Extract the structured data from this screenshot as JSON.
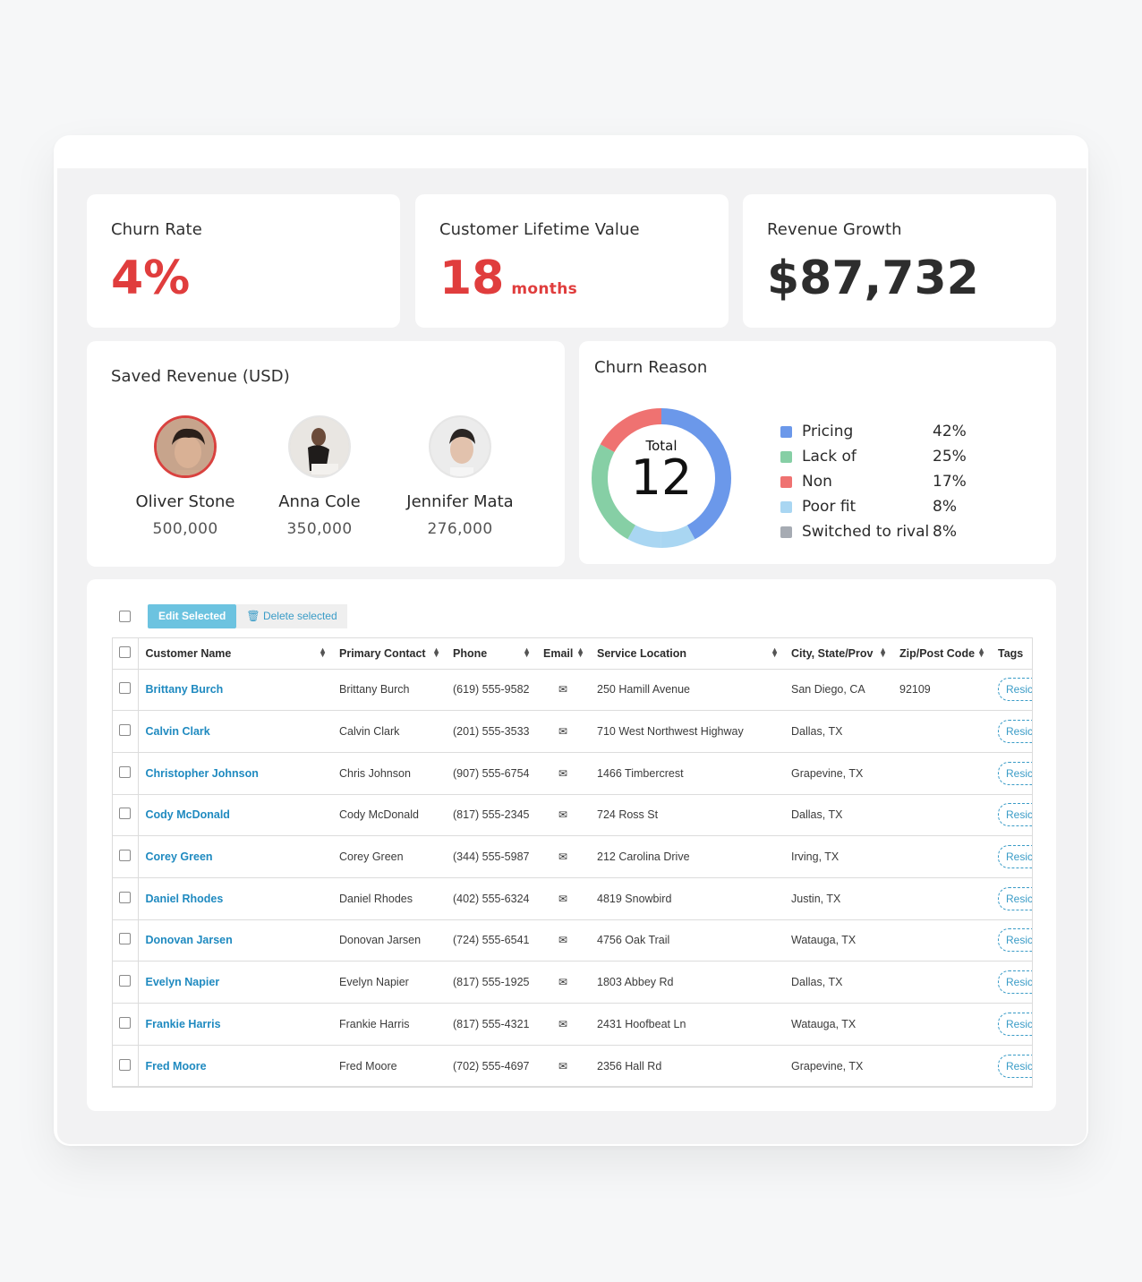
{
  "kpis": {
    "churn_rate": {
      "title": "Churn Rate",
      "value": "4%"
    },
    "clv": {
      "title": "Customer Lifetime Value",
      "value": "18",
      "unit": "months"
    },
    "revenue_growth": {
      "title": "Revenue Growth",
      "value": "$87,732"
    }
  },
  "saved_revenue": {
    "title": "Saved Revenue (USD)",
    "people": [
      {
        "name": "Oliver Stone",
        "value": "500,000"
      },
      {
        "name": "Anna Cole",
        "value": "350,000"
      },
      {
        "name": "Jennifer Mata",
        "value": "276,000"
      }
    ]
  },
  "churn_reason": {
    "title": "Churn Reason",
    "total_label": "Total",
    "total_value": "12",
    "legend": [
      {
        "label": "Pricing",
        "pct": "42%",
        "color": "#6b98ea"
      },
      {
        "label": "Lack of",
        "pct": "25%",
        "color": "#86cfa5"
      },
      {
        "label": "Non",
        "pct": "17%",
        "color": "#ef7271"
      },
      {
        "label": "Poor fit",
        "pct": "8%",
        "color": "#a9d6f2"
      },
      {
        "label": "Switched to rival",
        "pct": "8%",
        "color": "#a6abb3"
      }
    ]
  },
  "chart_data": {
    "type": "pie",
    "title": "Churn Reason",
    "categories": [
      "Pricing",
      "Lack of",
      "Non",
      "Poor fit",
      "Switched to rival"
    ],
    "values": [
      42,
      25,
      17,
      8,
      8
    ]
  },
  "toolbar": {
    "edit_label": "Edit Selected",
    "delete_label": "Delete selected"
  },
  "table": {
    "headers": [
      "Customer Name",
      "Primary Contact",
      "Phone",
      "Email",
      "Service Location",
      "City, State/Prov",
      "Zip/Post Code",
      "Tags"
    ],
    "rows": [
      {
        "name": "Brittany Burch",
        "contact": "Brittany Burch",
        "phone": "(619) 555-9582",
        "location": "250 Hamill Avenue",
        "city": "San Diego, CA",
        "zip": "92109",
        "tag": "Resic"
      },
      {
        "name": "Calvin Clark",
        "contact": "Calvin Clark",
        "phone": "(201) 555-3533",
        "location": "710 West Northwest Highway",
        "city": "Dallas, TX",
        "zip": "",
        "tag": "Resic"
      },
      {
        "name": "Christopher Johnson",
        "contact": "Chris Johnson",
        "phone": "(907) 555-6754",
        "location": "1466 Timbercrest",
        "city": "Grapevine, TX",
        "zip": "",
        "tag": "Resic"
      },
      {
        "name": "Cody McDonald",
        "contact": "Cody McDonald",
        "phone": "(817) 555-2345",
        "location": "724 Ross St",
        "city": "Dallas, TX",
        "zip": "",
        "tag": "Resic"
      },
      {
        "name": "Corey Green",
        "contact": "Corey Green",
        "phone": "(344) 555-5987",
        "location": "212 Carolina Drive",
        "city": "Irving, TX",
        "zip": "",
        "tag": "Resic"
      },
      {
        "name": "Daniel Rhodes",
        "contact": "Daniel Rhodes",
        "phone": "(402) 555-6324",
        "location": "4819 Snowbird",
        "city": "Justin, TX",
        "zip": "",
        "tag": "Resic"
      },
      {
        "name": "Donovan Jarsen",
        "contact": "Donovan Jarsen",
        "phone": "(724) 555-6541",
        "location": "4756 Oak Trail",
        "city": "Watauga, TX",
        "zip": "",
        "tag": "Resic"
      },
      {
        "name": "Evelyn Napier",
        "contact": "Evelyn Napier",
        "phone": "(817) 555-1925",
        "location": "1803 Abbey Rd",
        "city": "Dallas, TX",
        "zip": "",
        "tag": "Resic"
      },
      {
        "name": "Frankie Harris",
        "contact": "Frankie Harris",
        "phone": "(817) 555-4321",
        "location": "2431 Hoofbeat Ln",
        "city": "Watauga, TX",
        "zip": "",
        "tag": "Resic"
      },
      {
        "name": "Fred Moore",
        "contact": "Fred Moore",
        "phone": "(702) 555-4697",
        "location": "2356 Hall Rd",
        "city": "Grapevine, TX",
        "zip": "",
        "tag": "Resic"
      }
    ]
  }
}
